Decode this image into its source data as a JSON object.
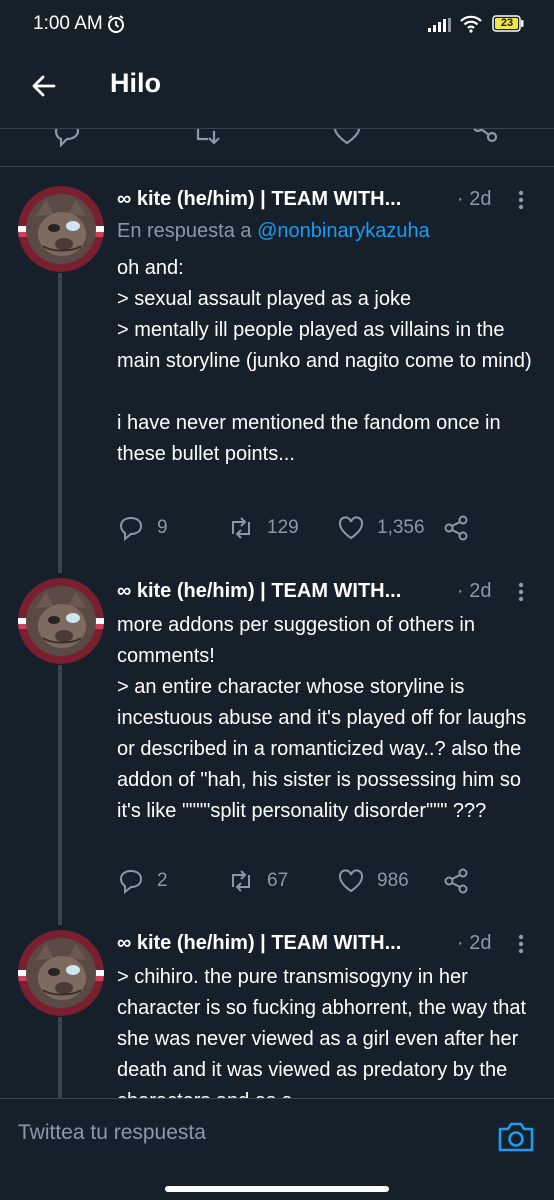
{
  "status_bar": {
    "time": "1:00 AM",
    "battery": "23",
    "icons": [
      "alarm-icon",
      "signal-icon",
      "wifi-icon",
      "battery-icon"
    ]
  },
  "header": {
    "title": "Hilo",
    "back_icon": "arrow-left-icon"
  },
  "previous_tweet_actions": [
    "reply-icon",
    "retweet-icon",
    "like-icon",
    "share-icon"
  ],
  "tweets": [
    {
      "display_name": "∞ kite (he/him) | TEAM WITH...",
      "time": "· 2d",
      "reply_prefix": "En respuesta a ",
      "reply_handle": "@nonbinarykazuha",
      "text": "oh and:\n> sexual assault played as a joke\n> mentally ill people played as villains in the main storyline (junko and nagito come to mind)\n\ni have never mentioned the fandom once in these bullet points...",
      "replies": "9",
      "retweets": "129",
      "likes": "1,356"
    },
    {
      "display_name": "∞ kite (he/him) | TEAM WITH...",
      "time": "· 2d",
      "text": "more addons per suggestion of others in comments!\n> an entire character whose storyline is incestuous abuse and it's played off for laughs or described in a romanticized way..? also the addon of \"hah, his sister is possessing him so it's like \"\"\"\"split personality disorder\"\"\" ???",
      "replies": "2",
      "retweets": "67",
      "likes": "986"
    },
    {
      "display_name": "∞ kite (he/him) | TEAM WITH...",
      "time": "· 2d",
      "text": "> chihiro. the pure transmisogyny in her character is so fucking abhorrent, the way that she was never viewed as a girl even after her death and it was viewed as predatory by the characters and as a"
    }
  ],
  "reply_bar": {
    "placeholder": "Twittea tu respuesta",
    "camera_icon": "camera-icon"
  },
  "colors": {
    "background": "#15202b",
    "divider": "#38444d",
    "secondary_text": "#8b98a5",
    "accent": "#1d9bf0"
  }
}
